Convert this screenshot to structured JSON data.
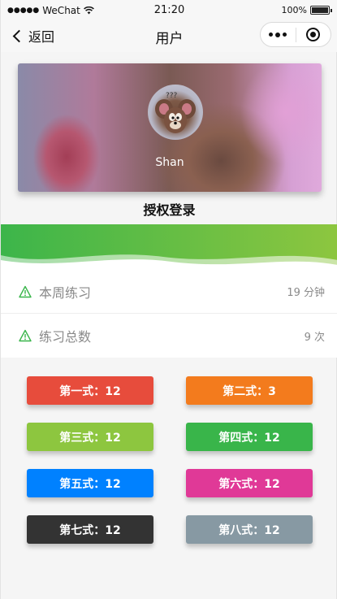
{
  "status_bar": {
    "signal_dots": "●●●●●",
    "carrier": "WeChat",
    "time": "21:20",
    "battery_percent": "100%",
    "battery_level": 1.0
  },
  "nav": {
    "back_label": "返回",
    "title": "用户"
  },
  "profile": {
    "username": "Shan",
    "avatar_question_marks": "???"
  },
  "auth": {
    "login_label": "授权登录"
  },
  "stats": [
    {
      "label": "本周练习",
      "value": "19 分钟",
      "icon": "warning-icon"
    },
    {
      "label": "练习总数",
      "value": "9 次",
      "icon": "warning-icon"
    }
  ],
  "moves": [
    {
      "label": "第一式：12",
      "color": "#e74c3c"
    },
    {
      "label": "第二式：3",
      "color": "#f37b1d"
    },
    {
      "label": "第三式：12",
      "color": "#8dc63f"
    },
    {
      "label": "第四式：12",
      "color": "#39b54a"
    },
    {
      "label": "第五式：12",
      "color": "#0081ff"
    },
    {
      "label": "第六式：12",
      "color": "#e03997"
    },
    {
      "label": "第七式：12",
      "color": "#333333"
    },
    {
      "label": "第八式：12",
      "color": "#8799a3"
    }
  ],
  "colors": {
    "wave_green_start": "#3cb54a",
    "wave_green_end": "#8dc63f",
    "icon_green": "#39b54a"
  }
}
